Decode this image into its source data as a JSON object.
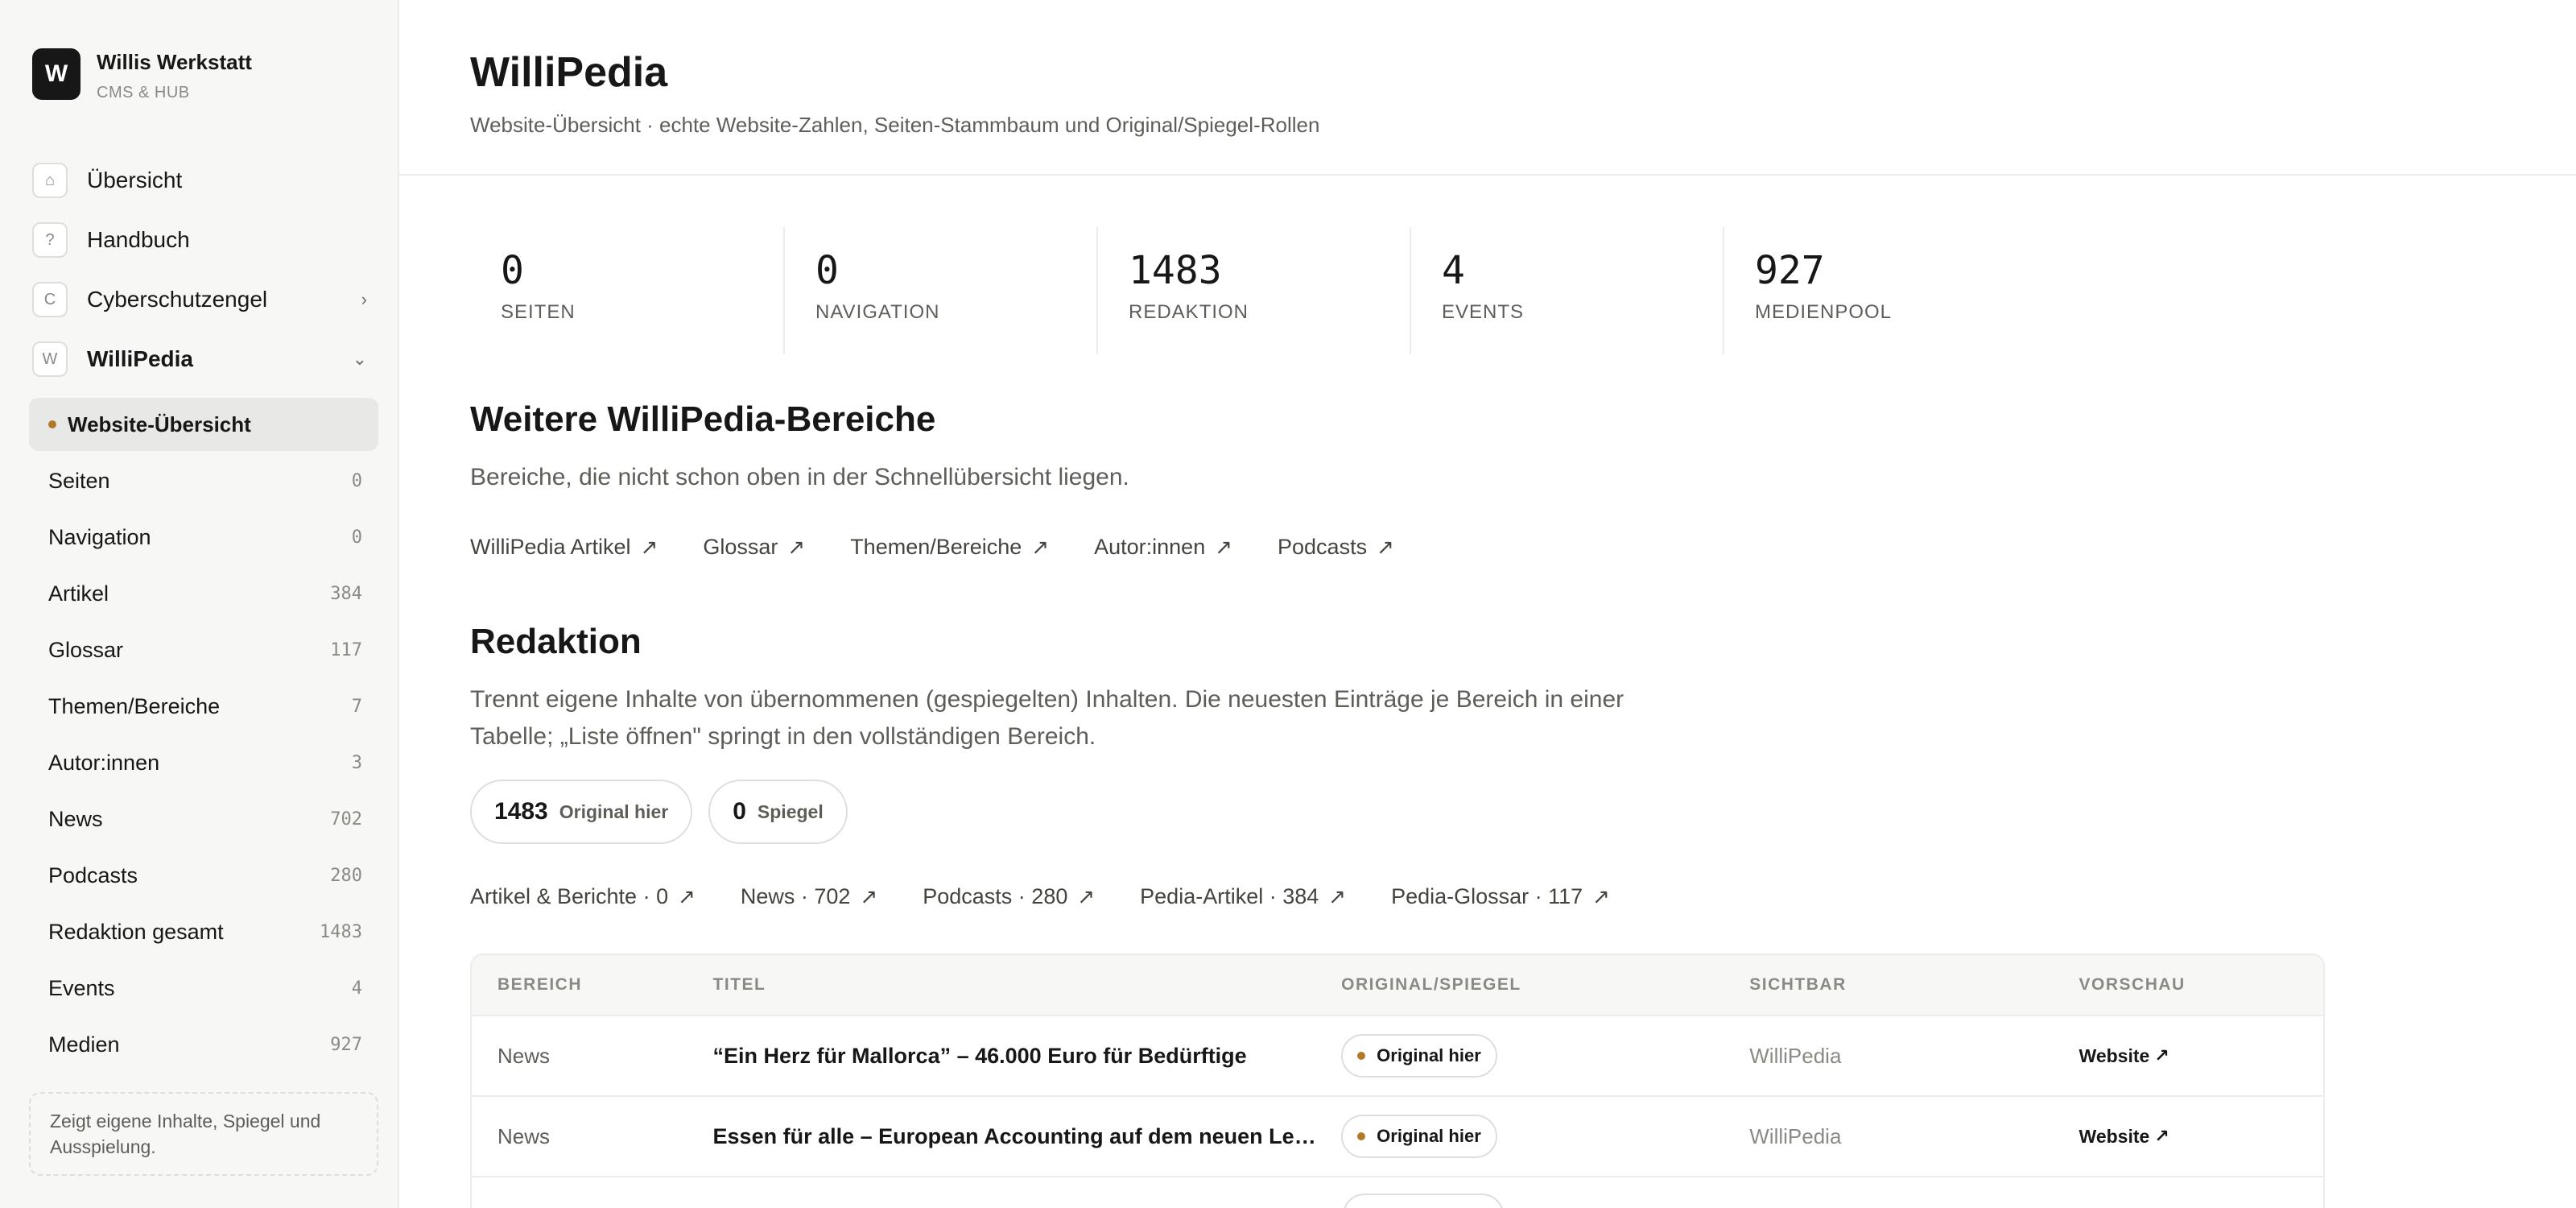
{
  "brand": {
    "logo_letter": "W",
    "name": "Willis Werkstatt",
    "subtitle": "CMS & HUB"
  },
  "nav_top": [
    {
      "icon": "⌂",
      "icon_name": "home-icon",
      "label": "Übersicht"
    },
    {
      "icon": "?",
      "icon_name": "help-icon",
      "label": "Handbuch"
    },
    {
      "icon": "C",
      "icon_name": "cyberschutzengel-icon",
      "label": "Cyberschutzengel",
      "chevron": "›"
    },
    {
      "icon": "W",
      "icon_name": "willipedia-icon",
      "label": "WilliPedia",
      "chevron": "⌄"
    }
  ],
  "nav_active": {
    "label": "Website-Übersicht",
    "dot_color": "#b07a2a"
  },
  "nav_sub": [
    {
      "label": "Seiten",
      "count": "0"
    },
    {
      "label": "Navigation",
      "count": "0"
    },
    {
      "label": "Artikel",
      "count": "384"
    },
    {
      "label": "Glossar",
      "count": "117"
    },
    {
      "label": "Themen/Bereiche",
      "count": "7"
    },
    {
      "label": "Autor:innen",
      "count": "3"
    },
    {
      "label": "News",
      "count": "702"
    },
    {
      "label": "Podcasts",
      "count": "280"
    },
    {
      "label": "Redaktion gesamt",
      "count": "1483"
    },
    {
      "label": "Events",
      "count": "4"
    },
    {
      "label": "Medien",
      "count": "927"
    }
  ],
  "sidebar_note": "Zeigt eigene Inhalte, Spiegel und Ausspielung.",
  "header": {
    "title": "WilliPedia",
    "subtitle": "Website-Übersicht · echte Website-Zahlen, Seiten-Stammbaum und Original/Spiegel-Rollen"
  },
  "stats": [
    {
      "value": "0",
      "label": "SEITEN"
    },
    {
      "value": "0",
      "label": "NAVIGATION"
    },
    {
      "value": "1483",
      "label": "REDAKTION"
    },
    {
      "value": "4",
      "label": "EVENTS"
    },
    {
      "value": "927",
      "label": "MEDIENPOOL"
    }
  ],
  "weitere": {
    "title": "Weitere WilliPedia-Bereiche",
    "desc": "Bereiche, die nicht schon oben in der Schnellübersicht liegen.",
    "links": [
      "WilliPedia Artikel",
      "Glossar",
      "Themen/Bereiche",
      "Autor:innen",
      "Podcasts"
    ]
  },
  "redaktion": {
    "title": "Redaktion",
    "desc_line1": "Trennt eigene Inhalte von übernommenen (gespiegelten) Inhalten. Die neuesten Einträge je Bereich in einer",
    "desc_line2": "Tabelle; „Liste öffnen\" springt in den vollständigen Bereich.",
    "pills": [
      {
        "value": "1483",
        "label": "Original hier"
      },
      {
        "value": "0",
        "label": "Spiegel"
      }
    ],
    "links": [
      "Artikel & Berichte · 0",
      "News · 702",
      "Podcasts · 280",
      "Pedia-Artikel · 384",
      "Pedia-Glossar · 117"
    ]
  },
  "table": {
    "headers": [
      "BEREICH",
      "TITEL",
      "ORIGINAL/SPIEGEL",
      "SICHTBAR",
      "VORSCHAU"
    ],
    "rows": [
      {
        "bereich": "News",
        "titel": "“Ein Herz für Mallorca” – 46.000 Euro für Bedürftige",
        "status": "Original hier",
        "sichtbar": "WilliPedia",
        "vorschau": "Website"
      },
      {
        "bereich": "News",
        "titel": "Essen für alle – European Accounting auf dem neuen Lebensmittelmarkt",
        "status": "Original hier",
        "sichtbar": "WilliPedia",
        "vorschau": "Website"
      },
      {
        "bereich": "",
        "titel": "",
        "status": "",
        "sichtbar": "",
        "vorschau": ""
      }
    ]
  },
  "arrow_glyph": "↗",
  "colors": {
    "accent_dot": "#b07a2a",
    "brand_bg": "#171717",
    "sidebar_bg": "#f7f7f6"
  }
}
